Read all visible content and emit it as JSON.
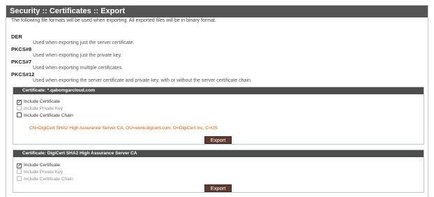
{
  "page": {
    "title": "Security :: Certificates :: Export",
    "intro": "The following file formats will be used when exporting. All exported files will be in binary format."
  },
  "formats": [
    {
      "name": "DER",
      "desc": "Used when exporting just the server certificate."
    },
    {
      "name": "PKCS#8",
      "desc": "Used when exporting just the private key."
    },
    {
      "name": "PKCS#7",
      "desc": "Used when exporting multiple certificates."
    },
    {
      "name": "PKCS#12",
      "desc": "Used when exporting the server certificate and private key, with or without the server certificate chain."
    }
  ],
  "certificates": [
    {
      "title": "Certificate: *.qabomgarcloud.com",
      "options": [
        {
          "label": "Include Certificate",
          "checked": true,
          "enabled": true
        },
        {
          "label": "Include Private Key",
          "checked": false,
          "enabled": false
        },
        {
          "label": "Include Certificate Chain",
          "checked": false,
          "enabled": true
        }
      ],
      "subject": "CN=DigiCert SHA2 High Assurance Server CA, OU=www.digicert.com, O=DigiCert Inc, C=US",
      "export_label": "Export"
    },
    {
      "title": "Certificate: DigiCert SHA2 High Assurance Server CA",
      "options": [
        {
          "label": "Include Certificate",
          "checked": true,
          "enabled": true
        },
        {
          "label": "Include Private Key",
          "checked": false,
          "enabled": false
        },
        {
          "label": "Include Certificate Chain",
          "checked": false,
          "enabled": false
        }
      ],
      "export_label": "Export"
    }
  ],
  "colors": {
    "title_bar": "#555555",
    "cert_header": "#4d4d4d",
    "export_button": "#5f3a2e",
    "subject_text": "#e05a00"
  }
}
